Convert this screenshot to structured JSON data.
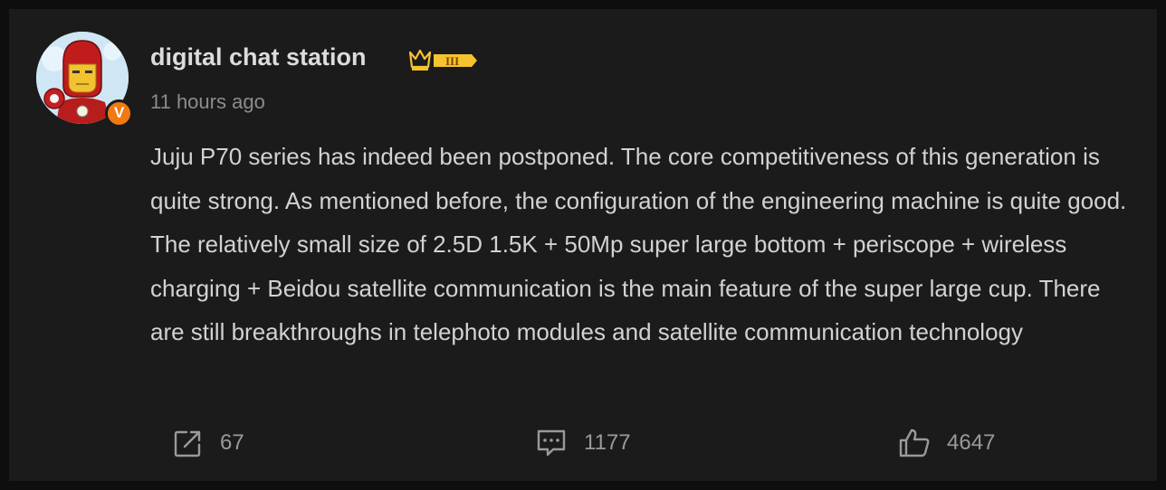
{
  "post": {
    "author": "digital chat station",
    "level_badge": "III",
    "verified_label": "V",
    "time": "11 hours ago",
    "text": "Juju P70 series has indeed been postponed. The core competitiveness of this generation is quite strong. As mentioned before, the configuration of the engineering machine is quite good. The relatively small size of 2.5D 1.5K + 50Mp super large bottom + periscope + wireless charging + Beidou satellite communication is the main feature of the super large cup. There are still breakthroughs in telephoto modules and satellite communication technology"
  },
  "actions": {
    "share_count": "67",
    "comment_count": "1177",
    "like_count": "4647"
  },
  "icons": {
    "share": "share-icon",
    "comment": "comment-icon",
    "like": "thumbs-up-icon",
    "crown": "crown-icon"
  },
  "colors": {
    "background": "#1b1b1b",
    "text": "#d2d2d2",
    "muted": "#8c8c8c",
    "verified": "#f07a10",
    "badge_gold": "#f5c330"
  }
}
